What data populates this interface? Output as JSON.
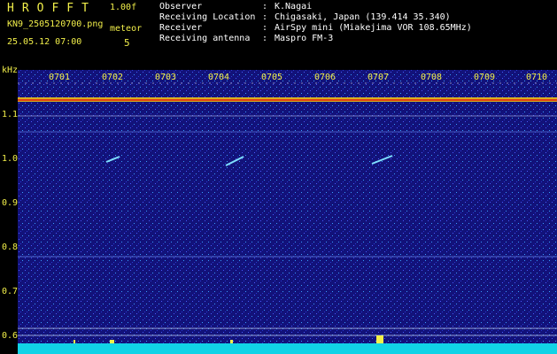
{
  "header": {
    "brand": "HROFFT",
    "version": "1.00f",
    "filename": "KN9_2505120700.png",
    "mode_label": "meteor",
    "count": "5",
    "timestamp": "25.05.12 07:00",
    "rows": [
      {
        "key": "Observer",
        "value": "K.Nagai"
      },
      {
        "key": "Receiving Location",
        "value": "Chigasaki, Japan (139.414 35.340)"
      },
      {
        "key": "Receiver",
        "value": "AirSpy mini (Miakejima VOR 108.65MHz)"
      },
      {
        "key": "Receiving antenna",
        "value": "Maspro FM-3"
      }
    ]
  },
  "spectrogram": {
    "y_unit": "kHz",
    "y_ticks": [
      "1.1",
      "1.0",
      "0.9",
      "0.8",
      "0.7",
      "0.6"
    ],
    "x_ticks": [
      "0701",
      "0702",
      "0703",
      "0704",
      "0705",
      "0706",
      "0707",
      "0708",
      "0709",
      "0710"
    ],
    "colors": {
      "background": "#12127a",
      "carrier": "#e04010",
      "floor": "#11d3e6",
      "label": "#f2ef4a"
    }
  }
}
